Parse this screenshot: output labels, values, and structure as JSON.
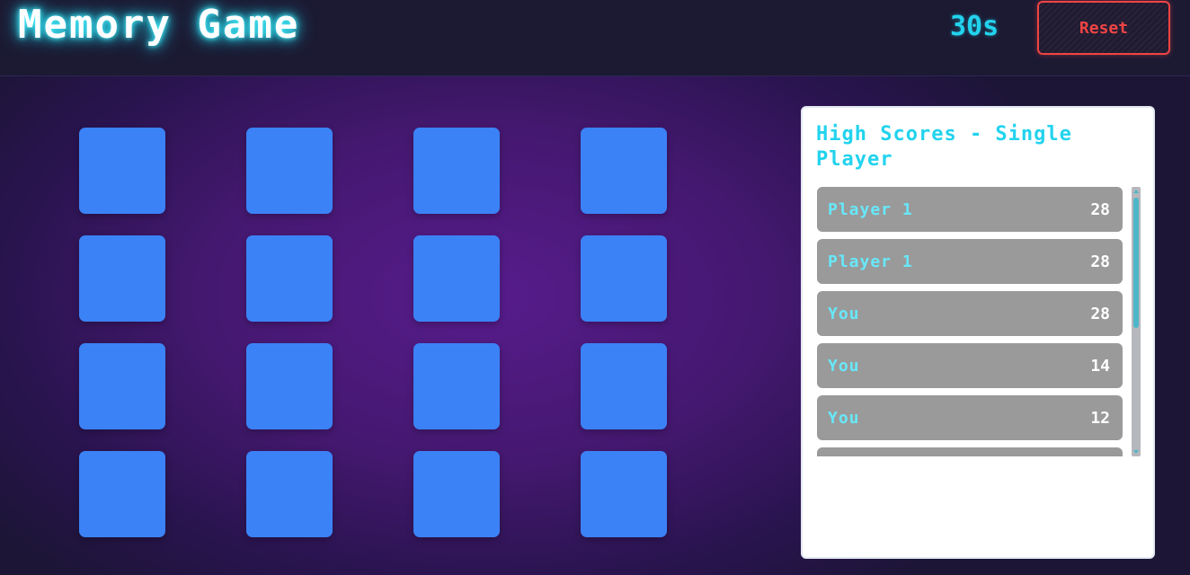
{
  "header": {
    "title": "Memory Game",
    "timer": "30s",
    "reset_label": "Reset"
  },
  "board": {
    "rows": 4,
    "columns": 4,
    "card_count": 16,
    "cards_face_down": true,
    "card_color": "#3b82f6"
  },
  "high_scores": {
    "title": "High Scores - Single Player",
    "entries": [
      {
        "name": "Player 1",
        "score": "28"
      },
      {
        "name": "Player 1",
        "score": "28"
      },
      {
        "name": "You",
        "score": "28"
      },
      {
        "name": "You",
        "score": "14"
      },
      {
        "name": "You",
        "score": "12"
      },
      {
        "name": "",
        "score": ""
      }
    ]
  },
  "colors": {
    "accent": "#22d3ee",
    "danger": "#ef4444",
    "header_bg": "#1c1a33",
    "background": "#571c8c",
    "row_bg": "#9a9a9a"
  }
}
